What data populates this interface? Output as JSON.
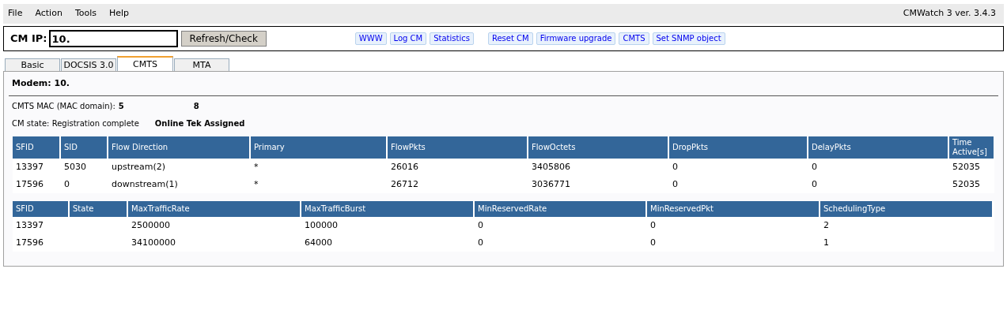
{
  "menu": [
    "File",
    "Action",
    "Tools",
    "Help"
  ],
  "app_version": "CMWatch 3 ver. 3.4.3",
  "toolbar": {
    "ip_label": "CM IP:",
    "ip_value": "10.",
    "refresh_button": "Refresh/Check",
    "links": [
      "WWW",
      "Log CM",
      "Statistics",
      "Reset CM",
      "Firmware upgrade",
      "CMTS",
      "Set SNMP object"
    ]
  },
  "tabs": [
    {
      "label": "Basic",
      "selected": false
    },
    {
      "label": "DOCSIS 3.0",
      "selected": false
    },
    {
      "label": "CMTS",
      "selected": true
    },
    {
      "label": "MTA",
      "selected": false
    }
  ],
  "modem": "Modem: 10.",
  "cmts_mac": {
    "label": "CMTS MAC (MAC domain):",
    "value_parts": [
      "5",
      "8"
    ]
  },
  "cm_state": {
    "label": "CM state: Registration complete",
    "value": "Online Tek Assigned"
  },
  "flow_table": {
    "columns": [
      "SFID",
      "SID",
      "Flow Direction",
      "Primary",
      "FlowPkts",
      "FlowOctets",
      "DropPkts",
      "DelayPkts",
      "Time Active[s]"
    ],
    "rows": [
      [
        "13397",
        "5030",
        "upstream(2)",
        "*",
        "26016",
        "3405806",
        "0",
        "0",
        "52035"
      ],
      [
        "17596",
        "0",
        "downstream(1)",
        "*",
        "26712",
        "3036771",
        "0",
        "0",
        "52035"
      ]
    ]
  },
  "qos_table": {
    "columns": [
      "SFID",
      "State",
      "MaxTrafficRate",
      "MaxTrafficBurst",
      "MinReservedRate",
      "MinReservedPkt",
      "SchedulingType"
    ],
    "rows": [
      [
        "13397",
        "",
        "2500000",
        "100000",
        "0",
        "0",
        "2"
      ],
      [
        "17596",
        "",
        "34100000",
        "64000",
        "0",
        "0",
        "1"
      ]
    ]
  }
}
